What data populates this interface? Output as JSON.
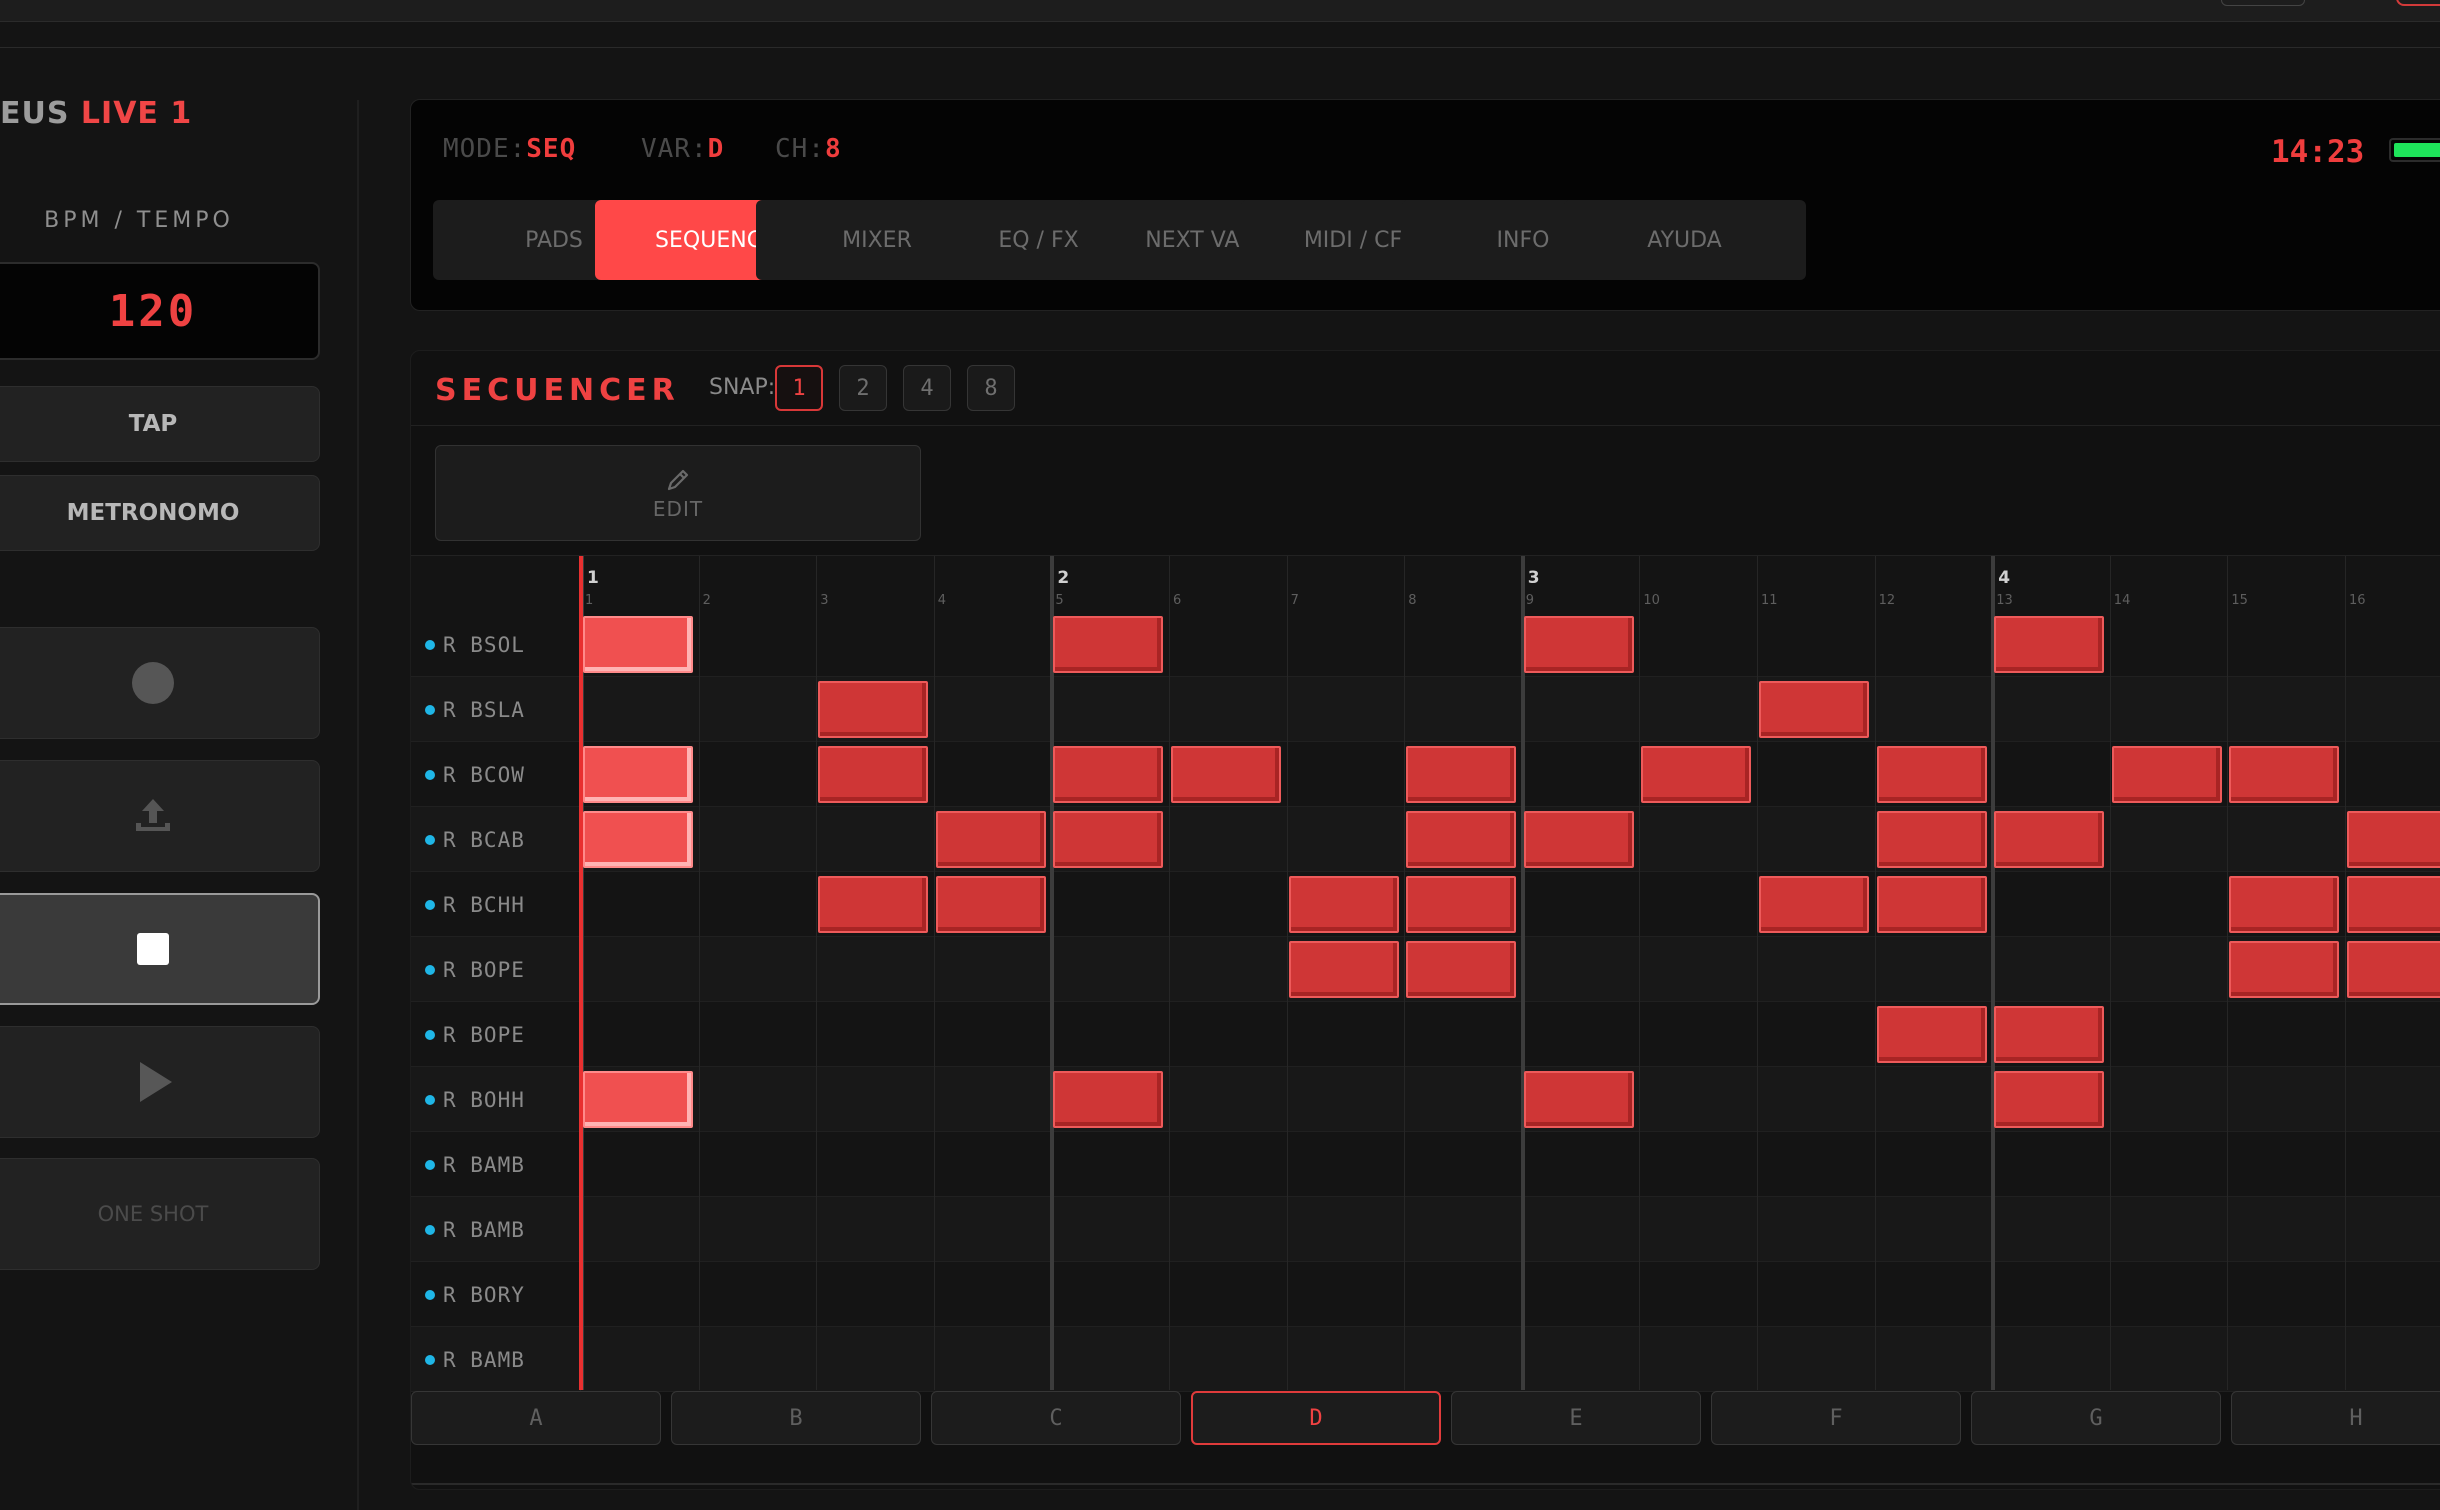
{
  "brand": {
    "part_a": "EUS",
    "part_b": "LIVE 1"
  },
  "left": {
    "bpm_label": "BPM / TEMPO",
    "bpm_value": "120",
    "tap_label": "TAP",
    "metronome_label": "METRONOMO",
    "one_shot_label": "ONE SHOT"
  },
  "header": {
    "mode_key": "MODE:",
    "mode_value": "SEQ",
    "var_key": "VAR:",
    "var_value": "D",
    "ch_key": "CH:",
    "ch_value": "8",
    "clock": "14:23",
    "battery_color": "#1ee35a",
    "tabs": [
      {
        "label": "PADS"
      },
      {
        "label": "SEQUENCE",
        "active": true
      },
      {
        "label": "MIXER"
      },
      {
        "label": "EQ / FX"
      },
      {
        "label": "NEXT VAR"
      },
      {
        "label": "MIDI / CFG"
      },
      {
        "label": "INFO"
      },
      {
        "label": "AYUDA"
      }
    ]
  },
  "sequencer": {
    "title": "SECUENCER",
    "snap_label": "SNAP:",
    "snap_options": [
      "1",
      "2",
      "4",
      "8"
    ],
    "snap_selected": 0,
    "edit_label": "EDIT",
    "edit_icon": "pencil-icon",
    "accent_color": "#ef4242",
    "bars": [
      "1",
      "2",
      "3",
      "4"
    ],
    "beats": [
      "1",
      "2",
      "3",
      "4",
      "5",
      "6",
      "7",
      "8",
      "9",
      "10",
      "11",
      "12",
      "13",
      "14",
      "15",
      "16"
    ],
    "playhead_step": 1,
    "tracks": [
      {
        "name": "R BSOL",
        "steps": [
          1,
          5,
          9,
          13
        ],
        "hot": [
          1
        ]
      },
      {
        "name": "R BSLA",
        "steps": [
          3,
          11
        ],
        "hot": []
      },
      {
        "name": "R BCOW",
        "steps": [
          1,
          3,
          5,
          6,
          8,
          10,
          12,
          14,
          15
        ],
        "hot": [
          1
        ]
      },
      {
        "name": "R BCAB",
        "steps": [
          1,
          4,
          5,
          8,
          9,
          12,
          13,
          16
        ],
        "hot": [
          1
        ]
      },
      {
        "name": "R BCHH",
        "steps": [
          3,
          4,
          7,
          8,
          11,
          12,
          15,
          16
        ],
        "hot": []
      },
      {
        "name": "R BOPE",
        "steps": [
          7,
          8,
          15,
          16
        ],
        "hot": []
      },
      {
        "name": "R BOPE",
        "steps": [
          12,
          13
        ],
        "hot": []
      },
      {
        "name": "R BOHH",
        "steps": [
          1,
          5,
          9,
          13
        ],
        "hot": [
          1
        ]
      },
      {
        "name": "R BAMB",
        "steps": [],
        "hot": []
      },
      {
        "name": "R BAMB",
        "steps": [],
        "hot": []
      },
      {
        "name": "R BORY",
        "steps": [],
        "hot": []
      },
      {
        "name": "R BAMB",
        "steps": [],
        "hot": []
      }
    ],
    "patterns": [
      "A",
      "B",
      "C",
      "D",
      "E",
      "F",
      "G",
      "H"
    ],
    "pattern_selected": 3
  }
}
